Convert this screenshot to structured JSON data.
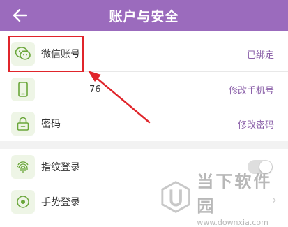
{
  "header": {
    "title": "账户与安全",
    "back_icon": "arrow-left-icon",
    "background": "#9b6bbd"
  },
  "rows": {
    "wechat": {
      "label": "微信账号",
      "value": "已绑定",
      "icon": "wechat-icon"
    },
    "phone": {
      "label": "",
      "number": "76",
      "value": "修改手机号",
      "icon": "phone-icon"
    },
    "password": {
      "label": "密码",
      "value": "修改密码",
      "icon": "lock-icon"
    },
    "fingerprint": {
      "label": "指纹登录",
      "icon": "fingerprint-icon",
      "toggle_on": false
    },
    "gesture": {
      "label": "手势登录",
      "icon": "gesture-icon"
    }
  },
  "colors": {
    "accent": "#8a5fa8",
    "highlight": "#e0252b",
    "icon_green": "#6aa63a"
  },
  "watermark": {
    "title": "当下软件园",
    "url": "www.downxia.com"
  }
}
